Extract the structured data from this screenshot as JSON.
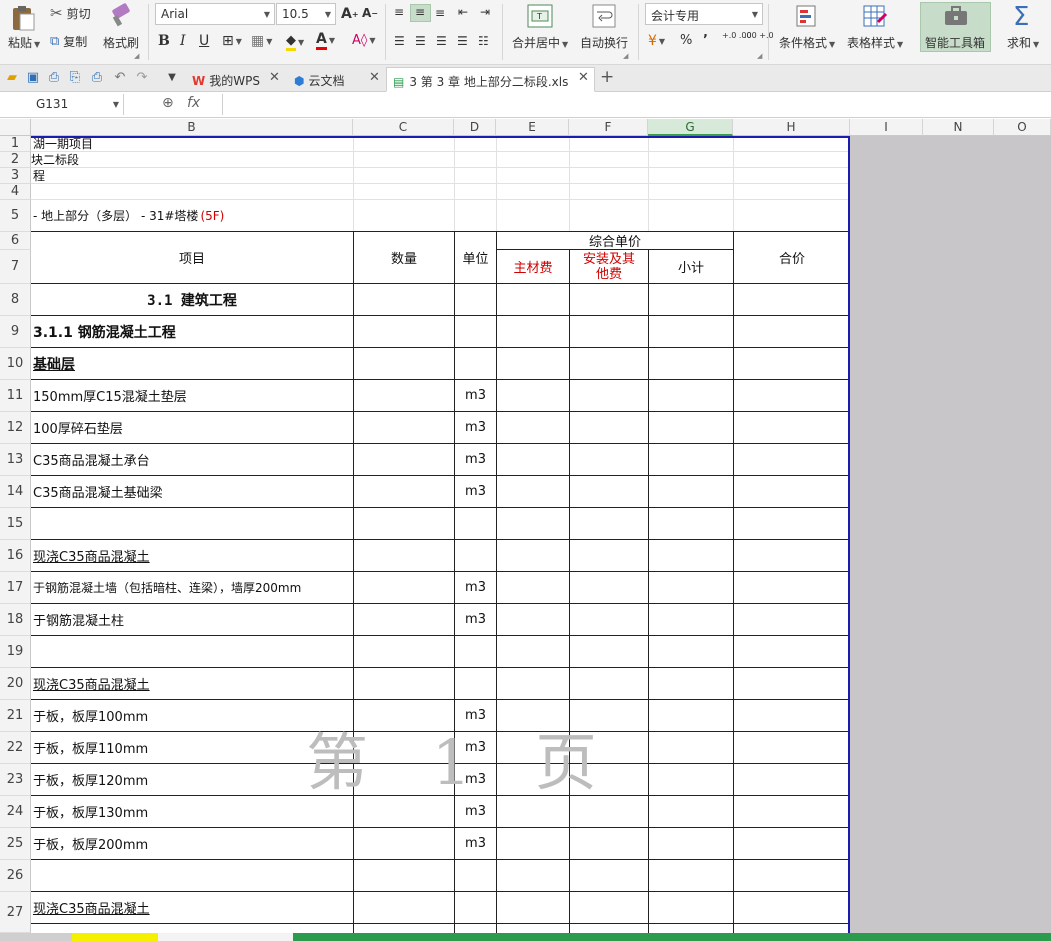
{
  "ribbon": {
    "paste": "粘贴",
    "cut": "剪切",
    "copy": "复制",
    "format_painter": "格式刷",
    "font_name": "Arial",
    "font_size": "10.5",
    "merge_center": "合并居中",
    "wrap_text": "自动换行",
    "number_format": "会计专用",
    "conditional_format": "条件格式",
    "table_style": "表格样式",
    "smart_toolbox": "智能工具箱",
    "sum": "求和",
    "percent": "%",
    "comma": "’",
    "increase_decimal": "+.0 .00",
    "decrease_decimal": ".00 +.0"
  },
  "tabs": {
    "my_wps": "我的WPS",
    "cloud_docs": "云文档",
    "active_doc": "3 第 3 章 地上部分二标段.xls"
  },
  "formula_bar": {
    "cell_ref": "G131",
    "fx": "fx",
    "value": ""
  },
  "columns": [
    "B",
    "C",
    "D",
    "E",
    "F",
    "G",
    "H",
    "I",
    "N",
    "O"
  ],
  "selected_column": "G",
  "rows": [
    "1",
    "2",
    "3",
    "4",
    "5",
    "6",
    "7",
    "8",
    "9",
    "10",
    "11",
    "12",
    "13",
    "14",
    "15",
    "16",
    "17",
    "18",
    "19",
    "20",
    "21",
    "22",
    "23",
    "24",
    "25",
    "26",
    "27"
  ],
  "sheet": {
    "r1": "湖一期项目",
    "r2": "块二标段",
    "r3": "程",
    "r5_text": "- 地上部分（多层） - 31#塔楼",
    "r5_red": "(5F)",
    "header_item": "项目",
    "header_qty": "数量",
    "header_unit": "单位",
    "header_unit_price": "综合单价",
    "header_material": "主材费",
    "header_install": "安装及其他费",
    "header_subtotal": "小计",
    "header_total": "合价",
    "r8": "3.1  建筑工程",
    "r9": "3.1.1 钢筋混凝土工程",
    "r10": "基础层",
    "r11": "150mm厚C15混凝土垫层",
    "r12": "100厚碎石垫层",
    "r13": "C35商品混凝土承台",
    "r14": "C35商品混凝土基础梁",
    "r16": "现浇C35商品混凝土",
    "r17": "于钢筋混凝土墙（包括暗柱、连梁），墙厚200mm",
    "r18": " 于钢筋混凝土柱",
    "r20": "现浇C35商品混凝土",
    "r21": "于板，板厚100mm",
    "r22": "于板，板厚110mm",
    "r23": "于板，板厚120mm",
    "r24": "于板，板厚130mm",
    "r25": "于板，板厚200mm",
    "r27": "现浇C35商品混凝土",
    "unit_m3": "m3"
  },
  "watermark": "第 1 页"
}
